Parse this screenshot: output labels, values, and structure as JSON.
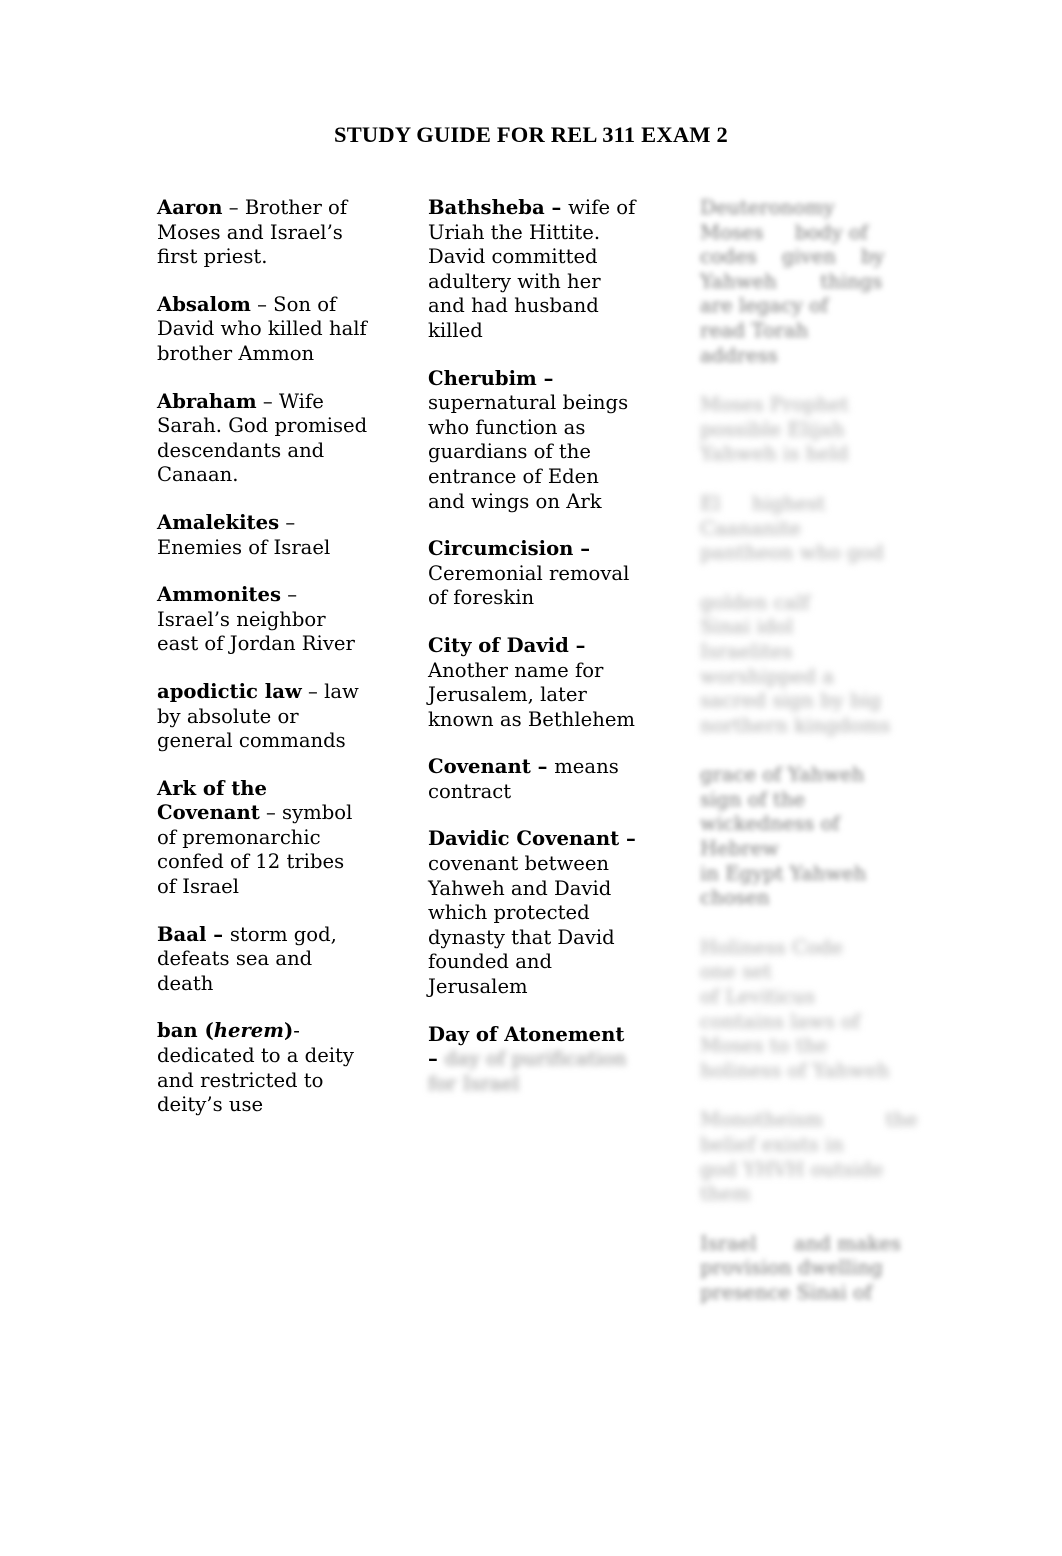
{
  "document": {
    "title": "STUDY GUIDE FOR REL 311 EXAM 2",
    "background_color": "#ffffff",
    "text_color": "#000000",
    "redacted_text_color": "#8e8e8e"
  },
  "columns": [
    {
      "id": "column-1",
      "entries": [
        {
          "term": "Aaron",
          "separator": " – ",
          "definition": "Brother of Moses and Israel’s first priest.",
          "redacted": false
        },
        {
          "term": "Absalom",
          "separator": " – ",
          "definition": "Son of David who killed half brother Ammon",
          "redacted": false
        },
        {
          "term": "Abraham",
          "separator": " – ",
          "definition": "Wife Sarah. God promised descendants and Canaan.",
          "redacted": false
        },
        {
          "term": "Amalekites",
          "separator": " – ",
          "definition": "Enemies of Israel",
          "redacted": false
        },
        {
          "term": "Ammonites",
          "separator": " – ",
          "definition": "Israel’s neighbor east of Jordan River",
          "redacted": false
        },
        {
          "term": "apodictic law",
          "separator": " – ",
          "definition": "law by absolute or general commands",
          "redacted": false
        },
        {
          "term": "Ark of the Covenant",
          "separator": " – ",
          "definition": "symbol of premonarchic confed of 12 tribes of Israel",
          "redacted": false
        },
        {
          "term": "Baal",
          "separator": " – ",
          "separator_bold": true,
          "definition": "storm god, defeats sea and death",
          "redacted": false
        },
        {
          "term": "ban (",
          "term_italic": "herem",
          "term_tail": ")",
          "separator": "-",
          "definition": "dedicated to a deity and restricted to deity’s use",
          "redacted": false
        }
      ]
    },
    {
      "id": "column-2",
      "entries": [
        {
          "term": "Bathsheba",
          "separator": " – ",
          "separator_bold": true,
          "definition": "wife of Uriah the Hittite. David committed adultery with her and had husband killed",
          "redacted": false
        },
        {
          "term": "Cherubim",
          "separator": " – ",
          "separator_bold": true,
          "definition": "supernatural beings who function as guardians of the entrance of Eden and wings on Ark",
          "redacted": false
        },
        {
          "term": "Circumcision",
          "separator": " – ",
          "separator_bold": true,
          "definition": "Ceremonial removal of foreskin",
          "redacted": false
        },
        {
          "term": "City of David",
          "separator": " – ",
          "separator_bold": true,
          "definition": "Another name for Jerusalem, later known as Bethlehem",
          "redacted": false
        },
        {
          "term": "Covenant",
          "separator": " – ",
          "separator_bold": true,
          "definition": "means contract",
          "redacted": false
        },
        {
          "term": "Davidic Covenant",
          "separator": " – ",
          "separator_bold": true,
          "definition": "covenant between Yahweh and David which protected dynasty that David founded and Jerusalem",
          "redacted": false
        },
        {
          "term": "Day of Atonement",
          "separator": " – ",
          "separator_bold": true,
          "definition": "day of purification for Israel",
          "redacted": true,
          "redaction_note": "definition text is blurred and illegible in the screenshot"
        }
      ]
    },
    {
      "id": "column-3",
      "fully_redacted": true,
      "redaction_note": "entire third column is blurred and illegible in the screenshot",
      "entries": [
        {
          "redacted": true,
          "lines": 6
        },
        {
          "redacted": true,
          "lines": 3
        },
        {
          "redacted": true,
          "lines": 3
        },
        {
          "redacted": true,
          "lines": 5
        },
        {
          "redacted": true,
          "lines": 4
        },
        {
          "redacted": true,
          "lines": 6
        },
        {
          "redacted": true,
          "lines": 4
        },
        {
          "redacted": true,
          "lines": 3
        }
      ]
    }
  ]
}
